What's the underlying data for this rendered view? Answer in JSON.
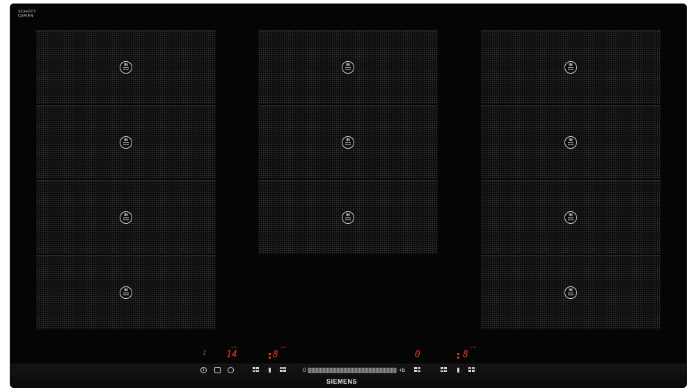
{
  "glass_mark": {
    "line1": "SCHOTT",
    "line2": "CERAN",
    "line3": ""
  },
  "zone_badge": {
    "top": "IN",
    "bottom": "boost"
  },
  "display": {
    "left_timer_small": "0:00",
    "left_timer": "14",
    "left_zone_small": "1-00",
    "left_zone_level": "8",
    "right_timer": "0",
    "right_zone_small": "1-00",
    "right_zone_level": "8",
    "left_marker": "I"
  },
  "controls": {
    "info_icon": "i",
    "slider_min": "0",
    "slider_max": "+b"
  },
  "brand": "SIEMENS",
  "icons": {
    "info": "info-icon",
    "child_lock": "child-lock-icon",
    "timer": "timer-icon",
    "zone_select": "zone-select-icon",
    "flex_zone": "flex-zone-icon",
    "slider": "power-slider"
  },
  "colors": {
    "glass": "#050505",
    "display_red": "#e23a2a",
    "print": "#d6d6d6"
  }
}
